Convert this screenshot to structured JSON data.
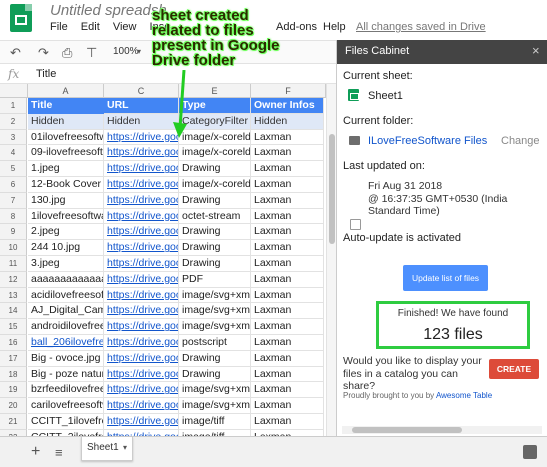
{
  "header": {
    "doc_title": "Untitled spreadsh",
    "menu": [
      "File",
      "Edit",
      "View",
      "Inse",
      "",
      "",
      "Add-ons",
      "Help"
    ],
    "saved_status": "All changes saved in Drive"
  },
  "toolbar": {
    "zoom": "100%"
  },
  "formula_bar": {
    "fx": "fx",
    "value": "Title"
  },
  "grid": {
    "columns": [
      "A",
      "C",
      "E",
      "F"
    ],
    "rows": [
      {
        "num": "1",
        "title": "Title",
        "url": "URL",
        "type": "Type",
        "owner": "Owner Infos"
      },
      {
        "num": "2",
        "title": "Hidden",
        "url": "Hidden",
        "type": "CategoryFilter - F",
        "owner": "Hidden"
      },
      {
        "num": "3",
        "title": "01ilovefreesoftwa",
        "url": "https://drive.goog",
        "type": "image/x-coreldra",
        "owner": "Laxman"
      },
      {
        "num": "4",
        "title": "09-ilovefreesoftw",
        "url": "https://drive.goog",
        "type": "image/x-coreldra",
        "owner": "Laxman"
      },
      {
        "num": "5",
        "title": "1.jpeg",
        "url": "https://drive.goog",
        "type": "Drawing",
        "owner": "Laxman"
      },
      {
        "num": "6",
        "title": "12-Book Cover (I",
        "url": "https://drive.goog",
        "type": "image/x-coreldra",
        "owner": "Laxman"
      },
      {
        "num": "7",
        "title": "130.jpg",
        "url": "https://drive.goog",
        "type": "Drawing",
        "owner": "Laxman"
      },
      {
        "num": "8",
        "title": "1ilovefreesoftwar",
        "url": "https://drive.goog",
        "type": "octet-stream",
        "owner": "Laxman"
      },
      {
        "num": "9",
        "title": "2.jpeg",
        "url": "https://drive.goog",
        "type": "Drawing",
        "owner": "Laxman"
      },
      {
        "num": "10",
        "title": "244 10.jpg",
        "url": "https://drive.goog",
        "type": "Drawing",
        "owner": "Laxman"
      },
      {
        "num": "11",
        "title": "3.jpeg",
        "url": "https://drive.goog",
        "type": "Drawing",
        "owner": "Laxman"
      },
      {
        "num": "12",
        "title": "aaaaaaaaaaaaaaa",
        "url": "https://drive.goog",
        "type": "PDF",
        "owner": "Laxman"
      },
      {
        "num": "13",
        "title": "acidilovefreesoftw",
        "url": "https://drive.goog",
        "type": "image/svg+xml",
        "owner": "Laxman"
      },
      {
        "num": "14",
        "title": "AJ_Digital_Came",
        "url": "https://drive.goog",
        "type": "image/svg+xml",
        "owner": "Laxman"
      },
      {
        "num": "15",
        "title": "androidilovefrees",
        "url": "https://drive.goog",
        "type": "image/svg+xml",
        "owner": "Laxman"
      },
      {
        "num": "16",
        "title": "ball_206ilovefree",
        "url": "https://drive.goog",
        "type": "postscript",
        "owner": "Laxman"
      },
      {
        "num": "17",
        "title": "Big - ovoce.jpg",
        "url": "https://drive.goog",
        "type": "Drawing",
        "owner": "Laxman"
      },
      {
        "num": "18",
        "title": "Big - poze natura",
        "url": "https://drive.goog",
        "type": "Drawing",
        "owner": "Laxman"
      },
      {
        "num": "19",
        "title": "bzrfeedilovefrees",
        "url": "https://drive.goog",
        "type": "image/svg+xml",
        "owner": "Laxman"
      },
      {
        "num": "20",
        "title": "carilovefreesoftw",
        "url": "https://drive.goog",
        "type": "image/svg+xml",
        "owner": "Laxman"
      },
      {
        "num": "21",
        "title": "CCITT_1ilovefree",
        "url": "https://drive.goog",
        "type": "image/tiff",
        "owner": "Laxman"
      },
      {
        "num": "22",
        "title": "CCITT_2ilovefree",
        "url": "https://drive.goog",
        "type": "image/tiff",
        "owner": "Laxman"
      }
    ]
  },
  "sheet_tabs": {
    "active": "Sheet1"
  },
  "sidebar": {
    "title": "Files Cabinet",
    "current_sheet_label": "Current sheet:",
    "current_sheet": "Sheet1",
    "current_folder_label": "Current folder:",
    "current_folder": "ILoveFreeSoftware Files",
    "change_label": "Change",
    "last_updated_label": "Last updated on:",
    "last_updated_line1": "Fri Aug 31 2018",
    "last_updated_line2": "@ 16:37:35 GMT+0530 (India Standard Time)",
    "auto_update": "Auto-update is activated",
    "update_button": "Update list of files",
    "found_message": "Finished! We have found",
    "found_count": "123 files",
    "catalog_question": "Would you like to display your files in a catalog you can share?",
    "create_button": "CREATE",
    "proudly": "Proudly brought to you by",
    "awesome_table": "Awesome Table"
  },
  "annotation": {
    "text": "sheet created related to files present in Google Drive folder",
    "color": "#6dff5a"
  }
}
